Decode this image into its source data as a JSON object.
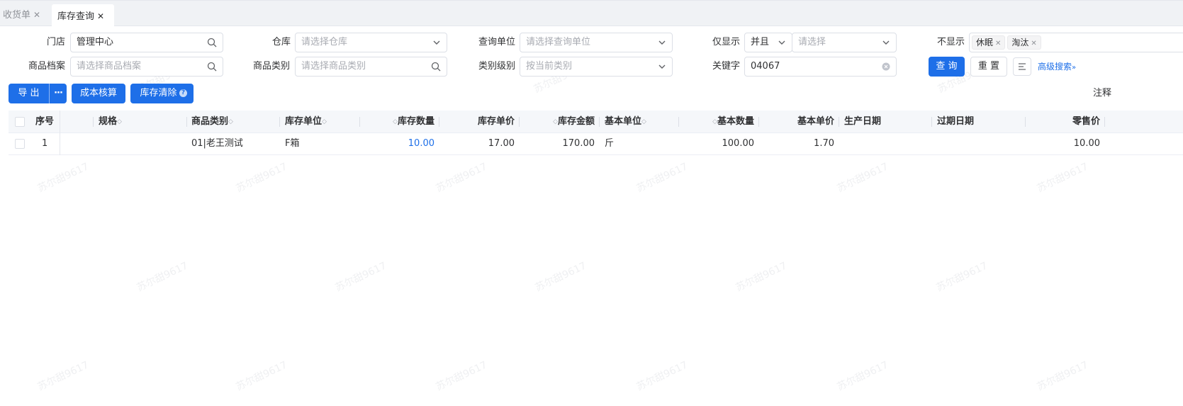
{
  "tabs": [
    {
      "label": "收货单",
      "active": false
    },
    {
      "label": "库存查询",
      "active": true
    }
  ],
  "filters": {
    "store": {
      "label": "门店",
      "value": "管理中心"
    },
    "warehouse": {
      "label": "仓库",
      "placeholder": "请选择仓库"
    },
    "query_unit": {
      "label": "查询单位",
      "placeholder": "请选择查询单位"
    },
    "only_show": {
      "label": "仅显示",
      "logic": "并且",
      "placeholder": "请选择"
    },
    "not_show": {
      "label": "不显示",
      "tags": [
        "休眠",
        "淘汰"
      ]
    },
    "product_archive": {
      "label": "商品档案",
      "placeholder": "请选择商品档案"
    },
    "product_category": {
      "label": "商品类别",
      "placeholder": "请选择商品类别"
    },
    "category_level": {
      "label": "类别级别",
      "placeholder": "按当前类别"
    },
    "keyword": {
      "label": "关键字",
      "value": "04067"
    }
  },
  "actions": {
    "query": "查 询",
    "reset": "重 置",
    "advanced": "高级搜索",
    "export": "导 出",
    "more": "···",
    "cost": "成本核算",
    "clear": "库存清除",
    "note": "注释"
  },
  "table": {
    "columns": [
      "序号",
      "规格",
      "商品类别",
      "库存单位",
      "库存数量",
      "库存单价",
      "库存金额",
      "基本单位",
      "基本数量",
      "基本单价",
      "生产日期",
      "过期日期",
      "零售价"
    ],
    "rows": [
      {
        "index": "1",
        "spec": "",
        "category": "01|老王测试",
        "stock_unit": "F箱",
        "qty": "10.00",
        "unit_price": "17.00",
        "amount": "170.00",
        "base_unit": "斤",
        "base_qty": "100.00",
        "base_price": "1.70",
        "prod_date": "",
        "exp_date": "",
        "retail": "10.00"
      }
    ]
  },
  "watermark": "苏尔甜9617",
  "colors": {
    "primary": "#1e6fe8",
    "link_value": "#1e6fe8"
  }
}
